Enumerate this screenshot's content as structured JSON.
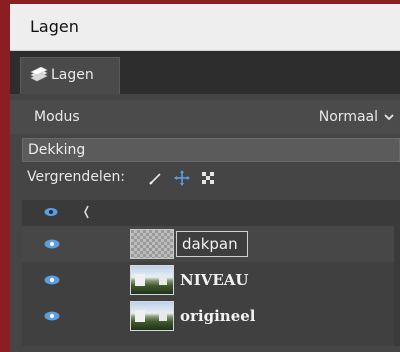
{
  "window": {
    "title": "Lagen"
  },
  "tabs": [
    {
      "label": "Lagen",
      "icon": "layers-icon"
    }
  ],
  "mode": {
    "label": "Modus",
    "value": "Normaal"
  },
  "opacity": {
    "label": "Dekking"
  },
  "lock": {
    "label": "Vergrendelen:",
    "icons": [
      "lock-paint-icon",
      "lock-position-icon",
      "lock-alpha-icon"
    ]
  },
  "layers": [
    {
      "name": "dakpan",
      "visible": true,
      "thumbnail": "transparent-checker",
      "editing": true
    },
    {
      "name": "NIVEAU",
      "visible": true,
      "thumbnail": "photo"
    },
    {
      "name": "origineel",
      "visible": true,
      "thumbnail": "photo"
    }
  ],
  "colors": {
    "accent": "#5a9ee0",
    "frame": "#8a1e22"
  }
}
